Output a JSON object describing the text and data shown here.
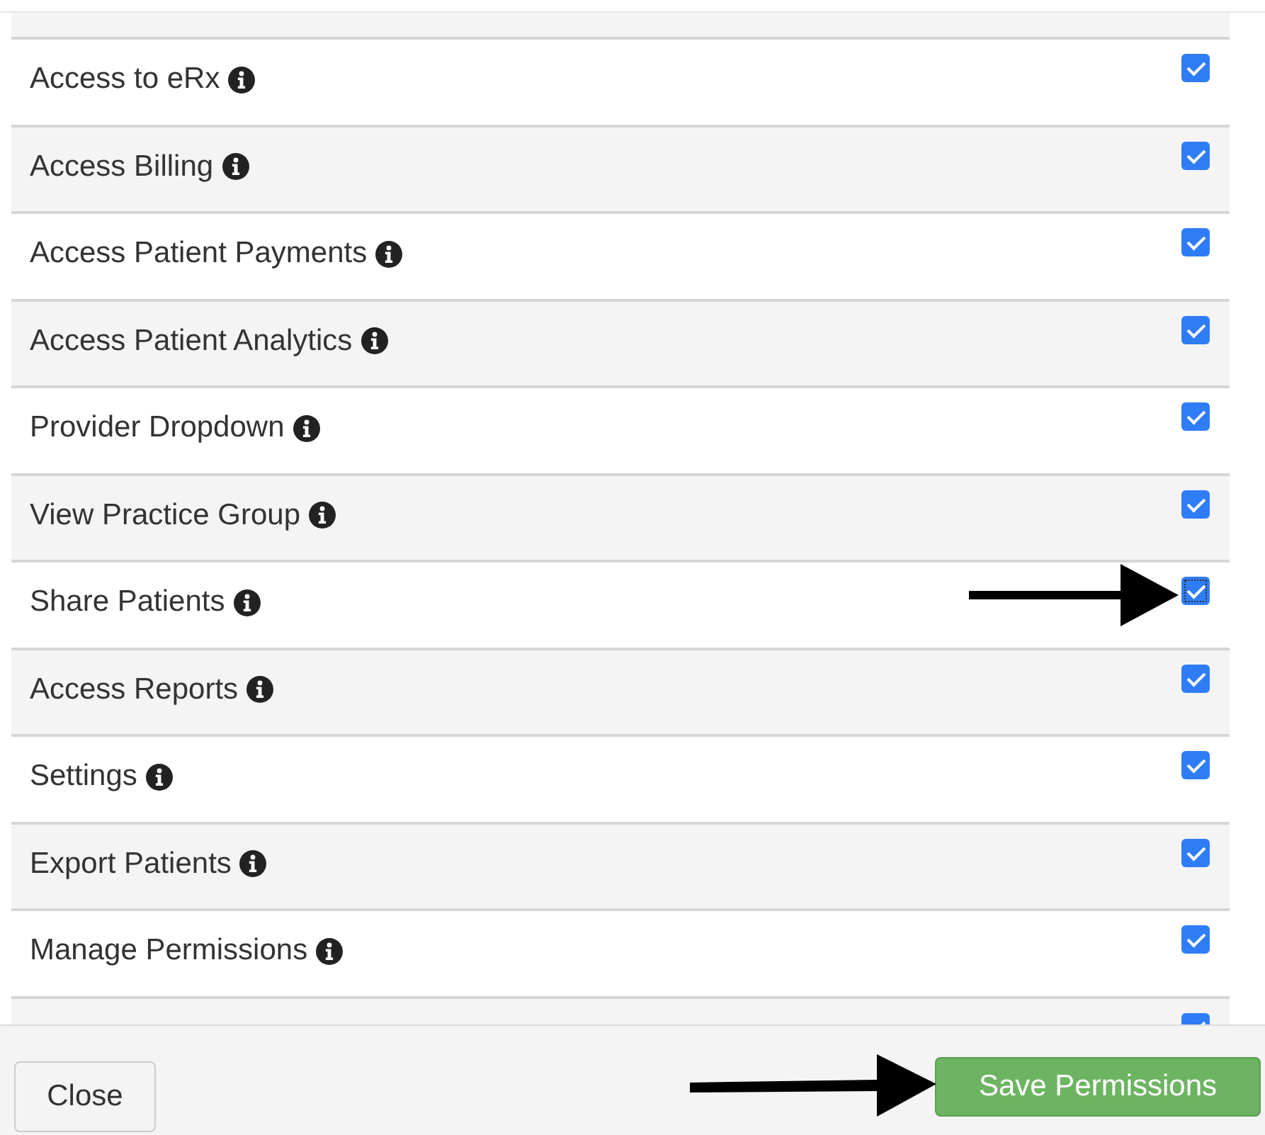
{
  "permissions": [
    {
      "label": "Access to eRx",
      "checked": true
    },
    {
      "label": "Access Billing",
      "checked": true
    },
    {
      "label": "Access Patient Payments",
      "checked": true
    },
    {
      "label": "Access Patient Analytics",
      "checked": true
    },
    {
      "label": "Provider Dropdown",
      "checked": true
    },
    {
      "label": "View Practice Group",
      "checked": true
    },
    {
      "label": "Share Patients",
      "checked": true,
      "focused": true
    },
    {
      "label": "Access Reports",
      "checked": true
    },
    {
      "label": "Settings",
      "checked": true
    },
    {
      "label": "Export Patients",
      "checked": true
    },
    {
      "label": "Manage Permissions",
      "checked": true
    },
    {
      "checked": true
    }
  ],
  "footer": {
    "close": "Close",
    "save": "Save Permissions"
  }
}
